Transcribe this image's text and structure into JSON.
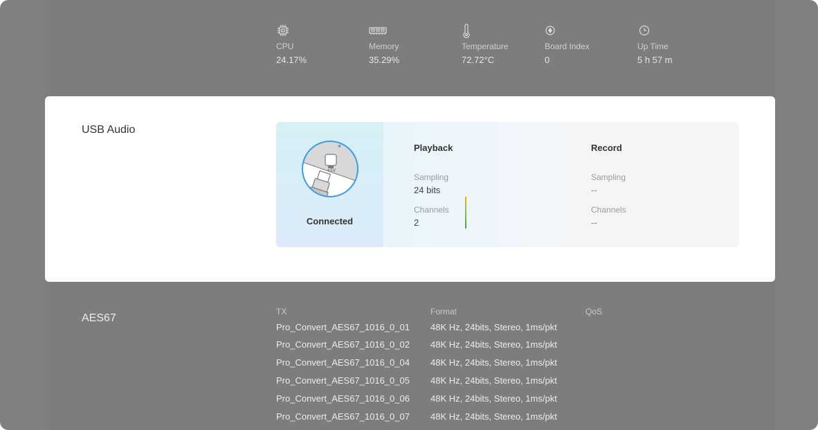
{
  "stats": [
    {
      "icon": "cpu-icon",
      "label": "CPU",
      "value": "24.17%"
    },
    {
      "icon": "memory-icon",
      "label": "Memory",
      "value": "35.29%"
    },
    {
      "icon": "thermometer-icon",
      "label": "Temperature",
      "value": "72.72°C"
    },
    {
      "icon": "board-index-icon",
      "label": "Board Index",
      "value": "0"
    },
    {
      "icon": "clock-icon",
      "label": "Up Time",
      "value": "5 h 57 m"
    }
  ],
  "usb": {
    "title": "USB Audio",
    "status": "Connected",
    "illustration_usb_text": "+5V",
    "playback": {
      "title": "Playback",
      "sampling_label": "Sampling",
      "sampling_value": "24 bits",
      "channels_label": "Channels",
      "channels_value": "2"
    },
    "record": {
      "title": "Record",
      "sampling_label": "Sampling",
      "sampling_value": "--",
      "channels_label": "Channels",
      "channels_value": "--"
    }
  },
  "aes67": {
    "title": "AES67",
    "headers": {
      "tx": "TX",
      "format": "Format",
      "qos": "QoS"
    },
    "rows": [
      {
        "tx": "Pro_Convert_AES67_1016_0_01",
        "format": "48K Hz, 24bits, Stereo, 1ms/pkt"
      },
      {
        "tx": "Pro_Convert_AES67_1016_0_02",
        "format": "48K Hz, 24bits, Stereo, 1ms/pkt"
      },
      {
        "tx": "Pro_Convert_AES67_1016_0_04",
        "format": "48K Hz, 24bits, Stereo, 1ms/pkt"
      },
      {
        "tx": "Pro_Convert_AES67_1016_0_05",
        "format": "48K Hz, 24bits, Stereo, 1ms/pkt"
      },
      {
        "tx": "Pro_Convert_AES67_1016_0_06",
        "format": "48K Hz, 24bits, Stereo, 1ms/pkt"
      },
      {
        "tx": "Pro_Convert_AES67_1016_0_07",
        "format": "48K Hz, 24bits, Stereo, 1ms/pkt"
      }
    ]
  },
  "colors": {
    "overlay": "#808080",
    "card_bg": "#ffffff",
    "connected_bg": "#d6f0f6",
    "accent_blue": "#3b9be6",
    "meter_top": "#f0b400",
    "meter_bottom": "#3cae3c"
  }
}
